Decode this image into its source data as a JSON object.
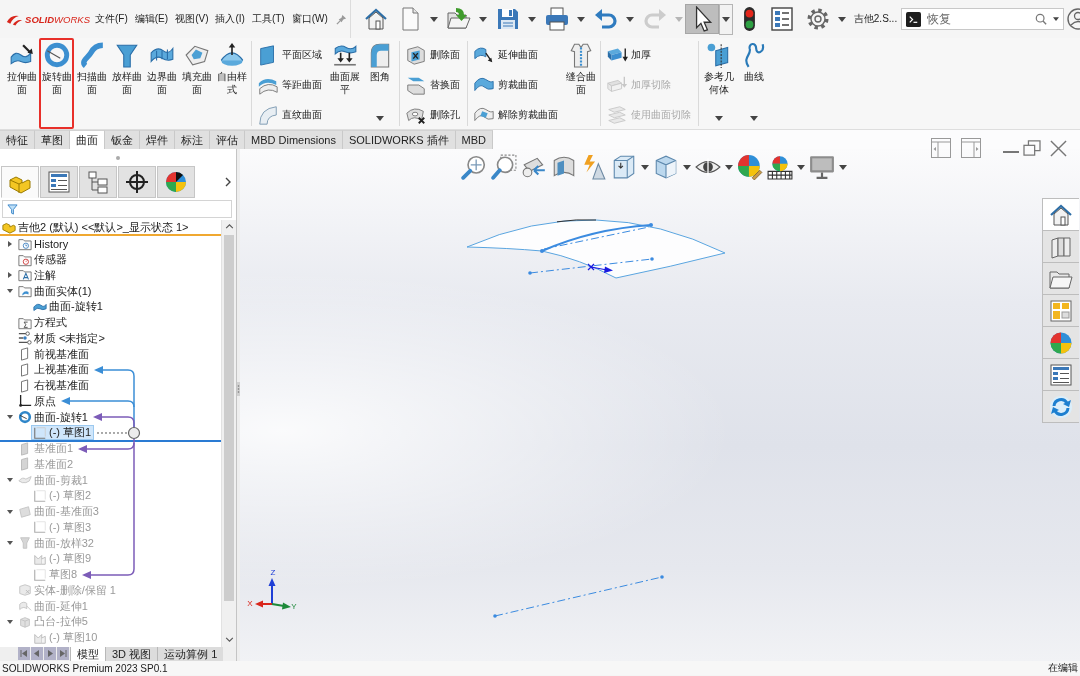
{
  "app": {
    "logo": "**SOLID**WORKS"
  },
  "menu": [
    "文件(F)",
    "编辑(E)",
    "视图(V)",
    "插入(I)",
    "工具(T)",
    "窗口(W)"
  ],
  "quick_access": [
    {
      "kind": "home",
      "disabled": false,
      "pressed": false
    },
    {
      "kind": "new",
      "dropdown": true,
      "disabled": false,
      "pressed": false
    },
    {
      "kind": "open",
      "dropdown": true,
      "disabled": false,
      "pressed": false
    },
    {
      "kind": "save",
      "dropdown": true,
      "disabled": false,
      "pressed": false
    },
    {
      "kind": "print",
      "dropdown": true,
      "disabled": false,
      "pressed": false
    },
    {
      "kind": "undo",
      "dropdown": true,
      "disabled": false,
      "pressed": false
    },
    {
      "kind": "redo",
      "dropdown": true,
      "disabled": true,
      "pressed": false
    },
    {
      "kind": "select",
      "dropdown": true,
      "disabled": false,
      "pressed": true
    },
    {
      "kind": "rebuild",
      "disabled": false,
      "pressed": false
    },
    {
      "kind": "options-list",
      "disabled": false,
      "pressed": false
    },
    {
      "kind": "settings",
      "dropdown": true,
      "disabled": false,
      "pressed": false
    }
  ],
  "document_name": "吉他2.S...",
  "search": {
    "placeholder": "恢复"
  },
  "ribbon": {
    "groups": [
      {
        "large_buttons": [
          {
            "label": "拉伸曲面",
            "kind": "extrude-surface",
            "dropdown": false,
            "disabled": false,
            "highlighted": false
          },
          {
            "label": "旋转曲面",
            "kind": "revolve-surface",
            "dropdown": false,
            "disabled": false,
            "highlighted": true
          },
          {
            "label": "扫描曲面",
            "kind": "sweep-surface",
            "dropdown": false,
            "disabled": false,
            "highlighted": false
          },
          {
            "label": "放样曲面",
            "kind": "loft-surface",
            "dropdown": false,
            "disabled": false,
            "highlighted": false
          },
          {
            "label": "边界曲面",
            "kind": "boundary-surface",
            "dropdown": false,
            "disabled": false,
            "highlighted": false
          },
          {
            "label": "填充曲面",
            "kind": "fill-surface",
            "dropdown": false,
            "disabled": false,
            "highlighted": false
          },
          {
            "label": "自由样式",
            "kind": "freeform",
            "dropdown": false,
            "disabled": false,
            "highlighted": false
          }
        ]
      },
      {
        "small_buttons": [
          {
            "label": "平面区域",
            "kind": "planar-surface",
            "dropdown": false,
            "disabled": false,
            "highlighted": false
          },
          {
            "label": "等距曲面",
            "kind": "offset-surface",
            "dropdown": false,
            "disabled": false,
            "highlighted": false
          },
          {
            "label": "直纹曲面",
            "kind": "ruled-surface",
            "dropdown": false,
            "disabled": false,
            "highlighted": false
          }
        ],
        "large_buttons": [
          {
            "label": "曲面展平",
            "kind": "flatten",
            "dropdown": false,
            "disabled": false,
            "highlighted": false
          },
          {
            "label": "图角",
            "kind": "fillet",
            "dropdown": true,
            "disabled": false,
            "highlighted": false
          }
        ]
      },
      {
        "small_buttons": [
          {
            "label": "删除面",
            "kind": "delete-face",
            "dropdown": false,
            "disabled": false,
            "highlighted": false
          },
          {
            "label": "替换面",
            "kind": "replace-face",
            "dropdown": false,
            "disabled": false,
            "highlighted": false
          },
          {
            "label": "删除孔",
            "kind": "delete-hole",
            "dropdown": false,
            "disabled": false,
            "highlighted": false
          }
        ]
      },
      {
        "small_buttons": [
          {
            "label": "延伸曲面",
            "kind": "extend-surface",
            "dropdown": false,
            "disabled": false,
            "highlighted": false
          },
          {
            "label": "剪裁曲面",
            "kind": "trim-surface",
            "dropdown": false,
            "disabled": false,
            "highlighted": false
          },
          {
            "label": "解除剪裁曲面",
            "kind": "untrim-surface",
            "dropdown": false,
            "disabled": false,
            "highlighted": false
          }
        ],
        "large_buttons": [
          {
            "label": "缝合曲面",
            "kind": "knit-surface",
            "dropdown": false,
            "disabled": false,
            "highlighted": false
          }
        ]
      },
      {
        "small_buttons": [
          {
            "label": "加厚",
            "kind": "thicken",
            "dropdown": false,
            "disabled": false,
            "highlighted": false
          },
          {
            "label": "加厚切除",
            "kind": "thicken-cut",
            "dropdown": false,
            "disabled": true,
            "highlighted": false
          },
          {
            "label": "使用曲面切除",
            "kind": "surface-cut",
            "dropdown": false,
            "disabled": true,
            "highlighted": false
          }
        ]
      },
      {
        "large_buttons": [
          {
            "label": "参考几何体",
            "kind": "reference-geometry",
            "dropdown": true,
            "disabled": false,
            "highlighted": false
          },
          {
            "label": "曲线",
            "kind": "curves",
            "dropdown": true,
            "disabled": false,
            "highlighted": false
          }
        ]
      }
    ]
  },
  "command_tabs": [
    {
      "label": "特征",
      "selected": false
    },
    {
      "label": "草图",
      "selected": false
    },
    {
      "label": "曲面",
      "selected": true
    },
    {
      "label": "钣金",
      "selected": false
    },
    {
      "label": "焊件",
      "selected": false
    },
    {
      "label": "标注",
      "selected": false
    },
    {
      "label": "评估",
      "selected": false
    },
    {
      "label": "MBD Dimensions",
      "selected": false
    },
    {
      "label": "SOLIDWORKS 插件",
      "selected": false
    },
    {
      "label": "MBD",
      "selected": false
    }
  ],
  "panel_tabs": [
    {
      "kind": "feature-manager",
      "selected": true
    },
    {
      "kind": "property-manager",
      "selected": false
    },
    {
      "kind": "configuration-manager",
      "selected": false
    },
    {
      "kind": "dimxpert",
      "selected": false
    },
    {
      "kind": "display-manager",
      "selected": false
    }
  ],
  "feature_tree": {
    "root": "吉他2 (默认) <<默认>_显示状态 1>",
    "items": [
      {
        "label": "History",
        "kind": "history",
        "expanded": false,
        "selected": false,
        "rolled_back": false
      },
      {
        "label": "传感器",
        "kind": "sensors",
        "selected": false,
        "rolled_back": false
      },
      {
        "label": "注解",
        "kind": "annotations",
        "expanded": false,
        "selected": false,
        "rolled_back": false
      },
      {
        "label": "曲面实体(1)",
        "kind": "surface-bodies",
        "expanded": true,
        "selected": false,
        "rolled_back": false,
        "children": [
          {
            "label": "曲面-旋转1",
            "kind": "surface-body",
            "selected": false,
            "rolled_back": false
          }
        ]
      },
      {
        "label": "方程式",
        "kind": "equations",
        "selected": false,
        "rolled_back": false
      },
      {
        "label": "材质 <未指定>",
        "kind": "material",
        "selected": false,
        "rolled_back": false
      },
      {
        "label": "前视基准面",
        "kind": "plane",
        "selected": false,
        "rolled_back": false
      },
      {
        "label": "上视基准面",
        "kind": "plane",
        "selected": false,
        "rolled_back": false,
        "color": "#3b8ed6"
      },
      {
        "label": "右视基准面",
        "kind": "plane",
        "selected": false,
        "rolled_back": false
      },
      {
        "label": "原点",
        "kind": "origin",
        "selected": false,
        "rolled_back": false,
        "color": "#3b8ed6"
      },
      {
        "label": "曲面-旋转1",
        "kind": "revolve",
        "expanded": true,
        "selected": false,
        "rolled_back": false,
        "color": "#7c5cb8",
        "children": [
          {
            "label": "(-) 草图1",
            "kind": "sketch",
            "selected": true,
            "rolled_back": false
          }
        ]
      },
      {
        "label": "基准面1",
        "kind": "plane-feature",
        "selected": false,
        "rolled_back": true,
        "color": "#7c5cb8"
      },
      {
        "label": "基准面2",
        "kind": "plane-feature",
        "selected": false,
        "rolled_back": true
      },
      {
        "label": "曲面-剪裁1",
        "kind": "trim",
        "expanded": true,
        "selected": false,
        "rolled_back": true,
        "children": [
          {
            "label": "(-) 草图2",
            "kind": "sketch",
            "selected": false,
            "rolled_back": true
          }
        ]
      },
      {
        "label": "曲面-基准面3",
        "kind": "planar",
        "expanded": true,
        "selected": false,
        "rolled_back": true,
        "children": [
          {
            "label": "(-) 草图3",
            "kind": "sketch",
            "selected": false,
            "rolled_back": true
          }
        ]
      },
      {
        "label": "曲面-放样32",
        "kind": "loft",
        "expanded": true,
        "selected": false,
        "rolled_back": true,
        "children": [
          {
            "label": "(-) 草图9",
            "kind": "sketch-3d",
            "selected": false,
            "rolled_back": true
          },
          {
            "label": "草图8",
            "kind": "sketch",
            "selected": false,
            "rolled_back": true,
            "color": "#7c5cb8"
          }
        ]
      },
      {
        "label": "实体-删除/保留 1",
        "kind": "delete-body",
        "selected": false,
        "rolled_back": true
      },
      {
        "label": "曲面-延伸1",
        "kind": "extend",
        "selected": false,
        "rolled_back": true
      },
      {
        "label": "凸台-拉伸5",
        "kind": "extrude",
        "expanded": true,
        "selected": false,
        "rolled_back": true,
        "children": [
          {
            "label": "(-) 草图10",
            "kind": "sketch-3d",
            "selected": false,
            "rolled_back": true
          }
        ]
      }
    ]
  },
  "view_tabs": [
    {
      "label": "模型",
      "selected": true
    },
    {
      "label": "3D 视图",
      "selected": false
    },
    {
      "label": "运动算例 1",
      "selected": false
    }
  ],
  "view_toolbar": [
    {
      "kind": "zoom-fit"
    },
    {
      "kind": "zoom-area"
    },
    {
      "kind": "previous-view"
    },
    {
      "kind": "section-view"
    },
    {
      "kind": "dynamic-annotation"
    },
    {
      "kind": "view-orientation",
      "dropdown": true
    },
    {
      "kind": "display-style",
      "dropdown": true
    },
    {
      "kind": "hide-show",
      "dropdown": true
    },
    {
      "kind": "edit-appearance"
    },
    {
      "kind": "apply-scene",
      "dropdown": true
    },
    {
      "kind": "view-settings",
      "dropdown": true
    }
  ],
  "task_pane": [
    {
      "kind": "resources",
      "selected": true
    },
    {
      "kind": "design-library",
      "selected": false
    },
    {
      "kind": "file-explorer",
      "selected": false
    },
    {
      "kind": "view-palette",
      "selected": false
    },
    {
      "kind": "appearances",
      "selected": false
    },
    {
      "kind": "custom-properties",
      "selected": false
    },
    {
      "kind": "forum",
      "selected": false
    }
  ],
  "triad": {
    "axes": [
      {
        "label": "Z",
        "color": "#1f3fd6"
      },
      {
        "label": "X",
        "color": "#d9261c"
      },
      {
        "label": "Y",
        "color": "#1d8a3a"
      }
    ]
  },
  "status_bar": {
    "product": "SOLIDWORKS Premium 2023 SP0.1",
    "mode": "在编辑"
  }
}
